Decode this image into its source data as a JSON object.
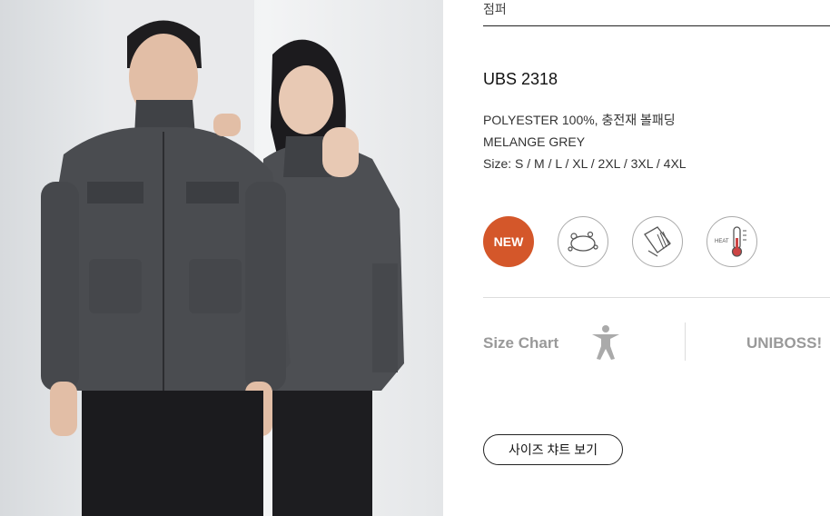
{
  "product": {
    "category": "점퍼",
    "code": "UBS 2318",
    "material": "POLYESTER 100%, 충전재 볼패딩",
    "color": "MELANGE GREY",
    "sizes": "Size: S / M / L / XL / 2XL / 3XL / 4XL"
  },
  "badges": [
    {
      "label": "NEW",
      "icon": "new-badge"
    },
    {
      "icon": "breathable-icon"
    },
    {
      "icon": "cuff-detail-icon"
    },
    {
      "label": "HEAT",
      "icon": "thermometer-icon"
    }
  ],
  "size_chart": {
    "label": "Size Chart",
    "icon": "person-icon"
  },
  "brand": "UNIBOSS!",
  "button": {
    "label": "사이즈 챠트 보기"
  },
  "colors": {
    "new_badge": "#d4572a",
    "jacket": "#4a4c50"
  }
}
